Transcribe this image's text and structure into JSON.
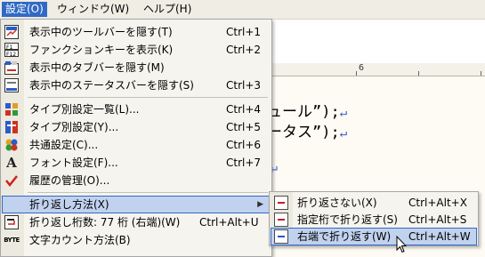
{
  "menubar": {
    "items": [
      {
        "label": "設定(O)",
        "active": true
      },
      {
        "label": "ウィンドウ(W)",
        "active": false
      },
      {
        "label": "ヘルプ(H)",
        "active": false
      }
    ]
  },
  "editor": {
    "ruler_label": "6",
    "lines": [
      "ュール”);",
      "ータス”);"
    ],
    "newline_mark": "↵"
  },
  "menu": {
    "items": [
      {
        "label": "表示中のツールバーを隠す(T)",
        "shortcut": "Ctrl+1",
        "icon": "toolbar-icon"
      },
      {
        "label": "ファンクションキーを表示(K)",
        "shortcut": "Ctrl+2",
        "icon": "function-key-icon"
      },
      {
        "label": "表示中のタブバーを隠す(M)",
        "shortcut": "",
        "icon": "tabbar-icon"
      },
      {
        "label": "表示中のステータスバーを隠す(S)",
        "shortcut": "Ctrl+3",
        "icon": "statusbar-icon"
      },
      {
        "label": "タイプ別設定一覧(L)...",
        "shortcut": "Ctrl+4",
        "icon": "type-list-icon"
      },
      {
        "label": "タイプ別設定(Y)...",
        "shortcut": "Ctrl+5",
        "icon": "type-settings-icon"
      },
      {
        "label": "共通設定(C)...",
        "shortcut": "Ctrl+6",
        "icon": "common-settings-icon"
      },
      {
        "label": "フォント設定(F)...",
        "shortcut": "Ctrl+7",
        "icon": "font-icon"
      },
      {
        "label": "履歴の管理(O)...",
        "shortcut": "",
        "icon": "checkmark-icon"
      },
      {
        "label": "折り返し方法(X)",
        "shortcut": "",
        "icon": "",
        "submenu": true,
        "highlighted": true
      },
      {
        "label": "折り返し桁数: 77 桁 (右端)(W)",
        "shortcut": "Ctrl+Alt+U",
        "icon": "wrap-column-icon"
      },
      {
        "label": "文字カウント方法(B)",
        "shortcut": "",
        "icon": "byte-icon"
      }
    ],
    "byte_icon_text": "BYTE",
    "font_icon_text": "A"
  },
  "submenu": {
    "items": [
      {
        "label": "折り返さない(X)",
        "shortcut": "Ctrl+Alt+X",
        "icon": "no-wrap-icon"
      },
      {
        "label": "指定桁で折り返す(S)",
        "shortcut": "Ctrl+Alt+S",
        "icon": "wrap-at-column-icon"
      },
      {
        "label": "右端で折り返す(W)",
        "shortcut": "Ctrl+Alt+W",
        "icon": "wrap-at-edge-icon",
        "highlighted": true
      }
    ]
  },
  "colors": {
    "highlight_fill": "#c1d2ee",
    "highlight_border": "#316ac5",
    "newline_mark": "#3a62c8"
  }
}
